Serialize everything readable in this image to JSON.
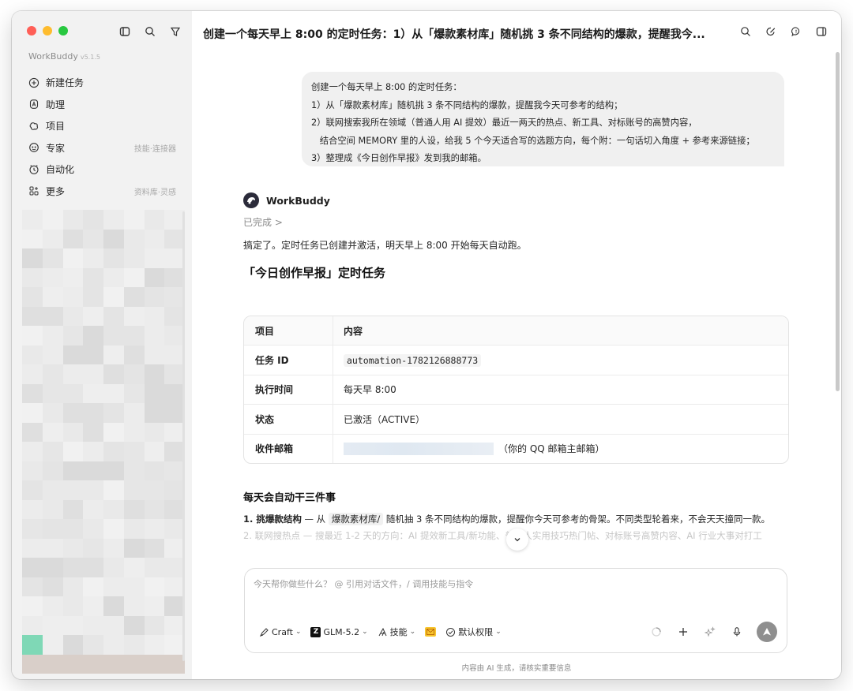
{
  "sidebar": {
    "app_name": "WorkBuddy",
    "version": "v5.1.5",
    "tool_icons": [
      "sidebar-toggle-icon",
      "search-icon",
      "filter-icon"
    ],
    "items": [
      {
        "label": "新建任务",
        "icon": "plus-circle-icon",
        "hint": ""
      },
      {
        "label": "助理",
        "icon": "assistant-icon",
        "hint": ""
      },
      {
        "label": "项目",
        "icon": "project-icon",
        "hint": ""
      },
      {
        "label": "专家",
        "icon": "expert-icon",
        "hint": "技能·连接器"
      },
      {
        "label": "自动化",
        "icon": "clock-icon",
        "hint": ""
      },
      {
        "label": "更多",
        "icon": "grid-icon",
        "hint": "资料库·灵感"
      }
    ]
  },
  "header": {
    "title": "创建一个每天早上 8:00 的定时任务：1）从「爆款素材库」随机挑 3 条不同结构的爆款，提醒我今...",
    "tool_icons": [
      "search-icon",
      "edit-icon",
      "feedback-icon",
      "panel-icon"
    ]
  },
  "user_message": {
    "lines": [
      "创建一个每天早上 8:00 的定时任务：",
      "1）从「爆款素材库」随机挑 3 条不同结构的爆款，提醒我今天可参考的结构；",
      "2）联网搜索我所在领域（普通人用 AI 提效）最近一两天的热点、新工具、对标账号的高赞内容，",
      "   结合空间 MEMORY 里的人设，给我 5 个今天适合写的选题方向，每个附：一句话切入角度 + 参考来源链接；",
      "3）整理成《今日创作早报》发到我的邮箱。"
    ]
  },
  "assistant": {
    "name": "WorkBuddy",
    "status": "已完成",
    "status_chevron": ">",
    "intro": "搞定了。定时任务已创建并激活，明天早上 8:00 开始每天自动跑。",
    "heading": "「今日创作早报」定时任务",
    "table": {
      "headers": [
        "项目",
        "内容"
      ],
      "rows": [
        {
          "key": "任务 ID",
          "value": "automation-1782126888773"
        },
        {
          "key": "执行时间",
          "value": "每天早 8:00"
        },
        {
          "key": "状态",
          "value": "已激活（ACTIVE）"
        },
        {
          "key": "收件邮箱",
          "value": "（你的 QQ 邮箱主邮箱）"
        }
      ]
    },
    "section_title": "每天会自动干三件事",
    "point1_bold": "1. 挑爆款结构",
    "point1_a": " — 从 ",
    "point1_tag": "爆款素材库/",
    "point1_b": " 随机抽 3 条不同结构的爆款，提醒你今天可参考的骨架。不同类型轮着来，不会天天撞同一款。",
    "point2_faded": "2. 联网搜热点 — 搜最近 1-2 天的方向：AI 提效新工具/新功能、普通人实用技巧热门帖、对标账号高赞内容、AI 行业大事对打工"
  },
  "composer": {
    "placeholder": "今天帮你做些什么？ @ 引用对话文件，/ 调用技能与指令",
    "mode": "Craft",
    "model": "GLM-5.2",
    "glm_letter": "Z",
    "skills": "技能",
    "permission": "默认权限"
  },
  "footer": "内容由 AI 生成，请核实重要信息",
  "colors": {
    "sidebar_bg": "#f2f2f2",
    "bubble_bg": "#f0f0f0",
    "send_button": "#8f8f8f",
    "mail_icon": "#f7c52e"
  }
}
